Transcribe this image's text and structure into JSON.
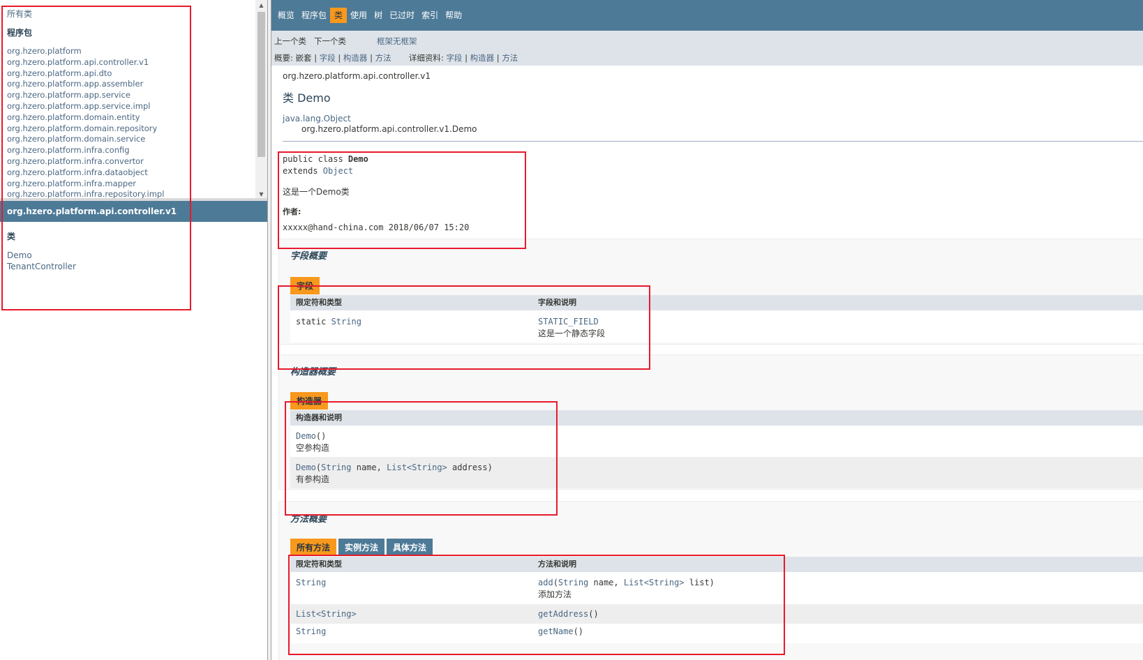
{
  "left_top": {
    "all_classes": "所有类",
    "packages_heading": "程序包",
    "packages": [
      "org.hzero.platform",
      "org.hzero.platform.api.controller.v1",
      "org.hzero.platform.api.dto",
      "org.hzero.platform.app.assembler",
      "org.hzero.platform.app.service",
      "org.hzero.platform.app.service.impl",
      "org.hzero.platform.domain.entity",
      "org.hzero.platform.domain.repository",
      "org.hzero.platform.domain.service",
      "org.hzero.platform.infra.config",
      "org.hzero.platform.infra.convertor",
      "org.hzero.platform.infra.dataobject",
      "org.hzero.platform.infra.mapper",
      "org.hzero.platform.infra.repository.impl"
    ]
  },
  "left_bottom": {
    "package_title": "org.hzero.platform.api.controller.v1",
    "classes_heading": "类",
    "classes": [
      "Demo",
      "TenantController"
    ]
  },
  "top_nav": {
    "items": [
      "概览",
      "程序包",
      "类",
      "使用",
      "树",
      "已过时",
      "索引",
      "帮助"
    ],
    "active_index": 2
  },
  "sub_nav": {
    "prev_class": "上一个类",
    "next_class": "下一个类",
    "frames": "框架",
    "no_frames": "无框架",
    "summary_label": "概要:",
    "summary_nested": "嵌套",
    "summary_field": "字段",
    "summary_constr": "构造器",
    "summary_method": "方法",
    "detail_label": "详细资料:",
    "detail_field": "字段",
    "detail_constr": "构造器",
    "detail_method": "方法",
    "sep": "|"
  },
  "class_info": {
    "package": "org.hzero.platform.api.controller.v1",
    "title": "类 Demo",
    "inherit_parent": "java.lang.Object",
    "inherit_self": "org.hzero.platform.api.controller.v1.Demo",
    "decl_public_class": "public class ",
    "decl_name": "Demo",
    "decl_extends": "extends ",
    "decl_super": "Object",
    "description": "这是一个Demo类",
    "author_label": "作者:",
    "author_value": "xxxxx@hand-china.com 2018/06/07 15:20"
  },
  "field_summary": {
    "heading": "字段概要",
    "caption": "字段",
    "col1": "限定符和类型",
    "col2": "字段和说明",
    "rows": [
      {
        "type_mod": "static ",
        "type_name": "String",
        "name": "STATIC_FIELD",
        "desc": "这是一个静态字段"
      }
    ]
  },
  "constructor_summary": {
    "heading": "构造器概要",
    "caption": "构造器",
    "col1": "构造器和说明",
    "rows": [
      {
        "name": "Demo",
        "params": "()",
        "desc": "空参构造"
      },
      {
        "name": "Demo",
        "p_open": "(",
        "p1type": "String",
        "p1": " name, ",
        "p2type": "List<String>",
        "p2": " address)",
        "desc": "有参构造"
      }
    ]
  },
  "method_summary": {
    "heading": "方法概要",
    "captions": [
      "所有方法",
      "实例方法",
      "具体方法"
    ],
    "col1": "限定符和类型",
    "col2": "方法和说明",
    "rows": [
      {
        "type": "String",
        "name": "add",
        "p_open": "(",
        "p1type": "String",
        "p1": " name, ",
        "p2type": "List<String>",
        "p2": " list)",
        "desc": "添加方法"
      },
      {
        "type": "List<String>",
        "name": "getAddress",
        "params": "()"
      },
      {
        "type": "String",
        "name": "getName",
        "params": "()"
      }
    ]
  },
  "colors": {
    "nav_blue": "#4d7a97",
    "accent_orange": "#f8981d",
    "annotation_red": "#e8192c"
  }
}
